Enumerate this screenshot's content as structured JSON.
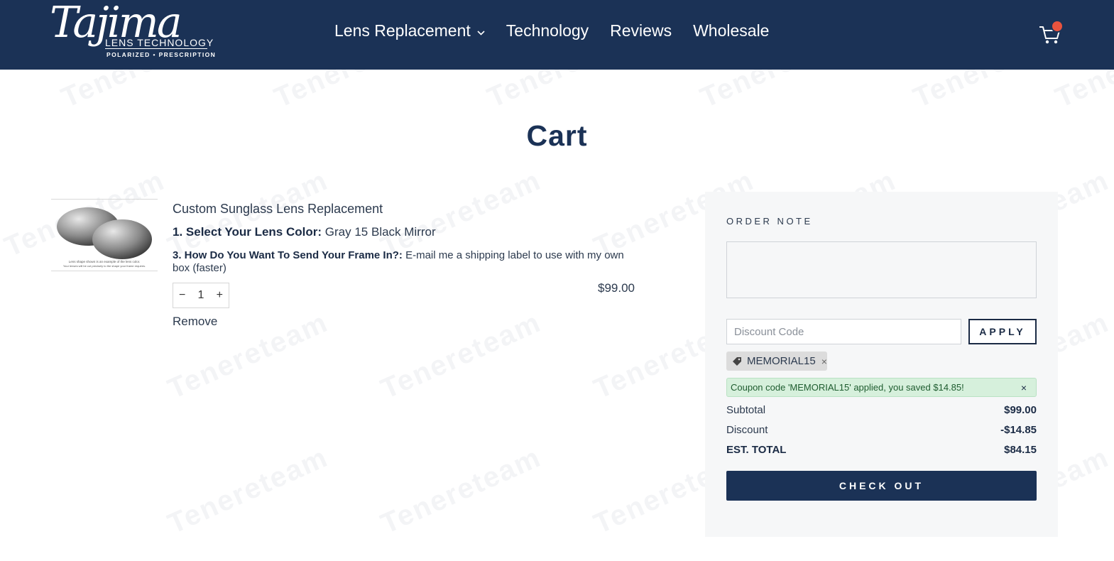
{
  "header": {
    "logo_script": "Tajima",
    "logo_line1": "LENS TECHNOLOGY",
    "logo_line2": "POLARIZED • PRESCRIPTION",
    "nav": [
      {
        "label": "Lens Replacement",
        "has_dropdown": true
      },
      {
        "label": "Technology"
      },
      {
        "label": "Reviews"
      },
      {
        "label": "Wholesale"
      }
    ],
    "cart_has_items": true
  },
  "page": {
    "title": "Cart"
  },
  "cart_item": {
    "title": "Custom Sunglass Lens Replacement",
    "option1_label": "1. Select Your Lens Color:",
    "option1_value": "Gray 15 Black Mirror",
    "option2_label": "3. How Do You Want To Send Your Frame In?:",
    "option2_value": "E-mail me a shipping label to use with my own box (faster)",
    "image_caption1": "Lens shape shown is an example of the lens color.",
    "image_caption2": "Your lenses will be cut precisely to the shape your frame requires.",
    "quantity": "1",
    "qty_minus": "−",
    "qty_plus": "+",
    "remove_label": "Remove",
    "price": "$99.00"
  },
  "summary": {
    "order_note_label": "ORDER NOTE",
    "discount_placeholder": "Discount Code",
    "apply_label": "APPLY",
    "applied_code": "MEMORIAL15",
    "remove_code_symbol": "×",
    "alert_message": "Coupon code 'MEMORIAL15' applied, you saved $14.85!",
    "alert_close_symbol": "×",
    "subtotal_label": "Subtotal",
    "subtotal_value": "$99.00",
    "discount_label": "Discount",
    "discount_value": "-$14.85",
    "total_label": "EST. TOTAL",
    "total_value": "$84.15",
    "checkout_label": "CHECK OUT"
  },
  "watermark": {
    "text": "Tenereteam"
  },
  "colors": {
    "header_bg": "#1b3256",
    "cart_badge": "#e8533e",
    "alert_bg": "#d6f0dc",
    "summary_bg": "#f6f7f8"
  }
}
